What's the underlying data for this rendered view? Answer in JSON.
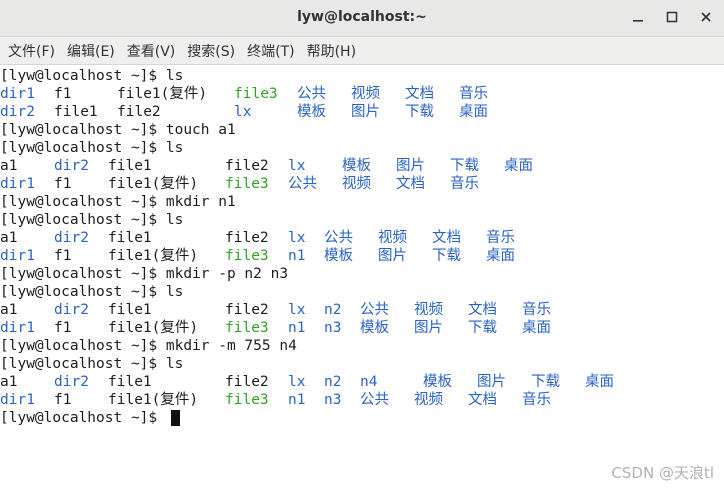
{
  "window": {
    "title": "lyw@localhost:~"
  },
  "menu": [
    "文件(F)",
    "编辑(E)",
    "查看(V)",
    "搜索(S)",
    "终端(T)",
    "帮助(H)"
  ],
  "terminal_lines": [
    [
      {
        "t": "[lyw@localhost ~]$ ls",
        "c": "default",
        "col": 0
      }
    ],
    [
      {
        "t": "dir1",
        "c": "blue",
        "col": 0
      },
      {
        "t": "f1",
        "c": "default",
        "col": 6
      },
      {
        "t": "file1(复件)",
        "c": "default",
        "col": 13
      },
      {
        "t": "file3",
        "c": "green",
        "col": 26
      },
      {
        "t": "公共",
        "c": "blue",
        "col": 33
      },
      {
        "t": "视频",
        "c": "blue",
        "col": 39
      },
      {
        "t": "文档",
        "c": "blue",
        "col": 45
      },
      {
        "t": "音乐",
        "c": "blue",
        "col": 51
      }
    ],
    [
      {
        "t": "dir2",
        "c": "blue",
        "col": 0
      },
      {
        "t": "file1",
        "c": "default",
        "col": 6
      },
      {
        "t": "file2",
        "c": "default",
        "col": 13
      },
      {
        "t": "lx",
        "c": "blue",
        "col": 26
      },
      {
        "t": "模板",
        "c": "blue",
        "col": 33
      },
      {
        "t": "图片",
        "c": "blue",
        "col": 39
      },
      {
        "t": "下载",
        "c": "blue",
        "col": 45
      },
      {
        "t": "桌面",
        "c": "blue",
        "col": 51
      }
    ],
    [
      {
        "t": "[lyw@localhost ~]$ touch a1",
        "c": "default",
        "col": 0
      }
    ],
    [
      {
        "t": "[lyw@localhost ~]$ ls",
        "c": "default",
        "col": 0
      }
    ],
    [
      {
        "t": "a1",
        "c": "default",
        "col": 0
      },
      {
        "t": "dir2",
        "c": "blue",
        "col": 6
      },
      {
        "t": "file1",
        "c": "default",
        "col": 12
      },
      {
        "t": "file2",
        "c": "default",
        "col": 25
      },
      {
        "t": "lx",
        "c": "blue",
        "col": 32
      },
      {
        "t": "模板",
        "c": "blue",
        "col": 38
      },
      {
        "t": "图片",
        "c": "blue",
        "col": 44
      },
      {
        "t": "下载",
        "c": "blue",
        "col": 50
      },
      {
        "t": "桌面",
        "c": "blue",
        "col": 56
      }
    ],
    [
      {
        "t": "dir1",
        "c": "blue",
        "col": 0
      },
      {
        "t": "f1",
        "c": "default",
        "col": 6
      },
      {
        "t": "file1(复件)",
        "c": "default",
        "col": 12
      },
      {
        "t": "file3",
        "c": "green",
        "col": 25
      },
      {
        "t": "公共",
        "c": "blue",
        "col": 32
      },
      {
        "t": "视频",
        "c": "blue",
        "col": 38
      },
      {
        "t": "文档",
        "c": "blue",
        "col": 44
      },
      {
        "t": "音乐",
        "c": "blue",
        "col": 50
      }
    ],
    [
      {
        "t": "[lyw@localhost ~]$ mkdir n1",
        "c": "default",
        "col": 0
      }
    ],
    [
      {
        "t": "[lyw@localhost ~]$ ls",
        "c": "default",
        "col": 0
      }
    ],
    [
      {
        "t": "a1",
        "c": "default",
        "col": 0
      },
      {
        "t": "dir2",
        "c": "blue",
        "col": 6
      },
      {
        "t": "file1",
        "c": "default",
        "col": 12
      },
      {
        "t": "file2",
        "c": "default",
        "col": 25
      },
      {
        "t": "lx",
        "c": "blue",
        "col": 32
      },
      {
        "t": "公共",
        "c": "blue",
        "col": 36
      },
      {
        "t": "视频",
        "c": "blue",
        "col": 42
      },
      {
        "t": "文档",
        "c": "blue",
        "col": 48
      },
      {
        "t": "音乐",
        "c": "blue",
        "col": 54
      }
    ],
    [
      {
        "t": "dir1",
        "c": "blue",
        "col": 0
      },
      {
        "t": "f1",
        "c": "default",
        "col": 6
      },
      {
        "t": "file1(复件)",
        "c": "default",
        "col": 12
      },
      {
        "t": "file3",
        "c": "green",
        "col": 25
      },
      {
        "t": "n1",
        "c": "blue",
        "col": 32
      },
      {
        "t": "模板",
        "c": "blue",
        "col": 36
      },
      {
        "t": "图片",
        "c": "blue",
        "col": 42
      },
      {
        "t": "下载",
        "c": "blue",
        "col": 48
      },
      {
        "t": "桌面",
        "c": "blue",
        "col": 54
      }
    ],
    [
      {
        "t": "[lyw@localhost ~]$ mkdir -p n2 n3",
        "c": "default",
        "col": 0
      }
    ],
    [
      {
        "t": "[lyw@localhost ~]$ ls",
        "c": "default",
        "col": 0
      }
    ],
    [
      {
        "t": "a1",
        "c": "default",
        "col": 0
      },
      {
        "t": "dir2",
        "c": "blue",
        "col": 6
      },
      {
        "t": "file1",
        "c": "default",
        "col": 12
      },
      {
        "t": "file2",
        "c": "default",
        "col": 25
      },
      {
        "t": "lx",
        "c": "blue",
        "col": 32
      },
      {
        "t": "n2",
        "c": "blue",
        "col": 36
      },
      {
        "t": "公共",
        "c": "blue",
        "col": 40
      },
      {
        "t": "视频",
        "c": "blue",
        "col": 46
      },
      {
        "t": "文档",
        "c": "blue",
        "col": 52
      },
      {
        "t": "音乐",
        "c": "blue",
        "col": 58
      }
    ],
    [
      {
        "t": "dir1",
        "c": "blue",
        "col": 0
      },
      {
        "t": "f1",
        "c": "default",
        "col": 6
      },
      {
        "t": "file1(复件)",
        "c": "default",
        "col": 12
      },
      {
        "t": "file3",
        "c": "green",
        "col": 25
      },
      {
        "t": "n1",
        "c": "blue",
        "col": 32
      },
      {
        "t": "n3",
        "c": "blue",
        "col": 36
      },
      {
        "t": "模板",
        "c": "blue",
        "col": 40
      },
      {
        "t": "图片",
        "c": "blue",
        "col": 46
      },
      {
        "t": "下载",
        "c": "blue",
        "col": 52
      },
      {
        "t": "桌面",
        "c": "blue",
        "col": 58
      }
    ],
    [
      {
        "t": "[lyw@localhost ~]$ mkdir -m 755 n4",
        "c": "default",
        "col": 0
      }
    ],
    [
      {
        "t": "[lyw@localhost ~]$ ls",
        "c": "default",
        "col": 0
      }
    ],
    [
      {
        "t": "a1",
        "c": "default",
        "col": 0
      },
      {
        "t": "dir2",
        "c": "blue",
        "col": 6
      },
      {
        "t": "file1",
        "c": "default",
        "col": 12
      },
      {
        "t": "file2",
        "c": "default",
        "col": 25
      },
      {
        "t": "lx",
        "c": "blue",
        "col": 32
      },
      {
        "t": "n2",
        "c": "blue",
        "col": 36
      },
      {
        "t": "n4",
        "c": "blue",
        "col": 40
      },
      {
        "t": "模板",
        "c": "blue",
        "col": 47
      },
      {
        "t": "图片",
        "c": "blue",
        "col": 53
      },
      {
        "t": "下载",
        "c": "blue",
        "col": 59
      },
      {
        "t": "桌面",
        "c": "blue",
        "col": 65
      }
    ],
    [
      {
        "t": "dir1",
        "c": "blue",
        "col": 0
      },
      {
        "t": "f1",
        "c": "default",
        "col": 6
      },
      {
        "t": "file1(复件)",
        "c": "default",
        "col": 12
      },
      {
        "t": "file3",
        "c": "green",
        "col": 25
      },
      {
        "t": "n1",
        "c": "blue",
        "col": 32
      },
      {
        "t": "n3",
        "c": "blue",
        "col": 36
      },
      {
        "t": "公共",
        "c": "blue",
        "col": 40
      },
      {
        "t": "视频",
        "c": "blue",
        "col": 46
      },
      {
        "t": "文档",
        "c": "blue",
        "col": 52
      },
      {
        "t": "音乐",
        "c": "blue",
        "col": 58
      }
    ],
    [
      {
        "t": "[lyw@localhost ~]$ ",
        "c": "default",
        "col": 0,
        "cursor": true
      }
    ]
  ],
  "watermark": "CSDN @天浪tl",
  "colors": {
    "blue": "#2a63c6",
    "green": "#2fa421",
    "default": "#1d1d1d"
  },
  "icons": [
    "minimize-icon",
    "maximize-icon",
    "close-icon"
  ]
}
